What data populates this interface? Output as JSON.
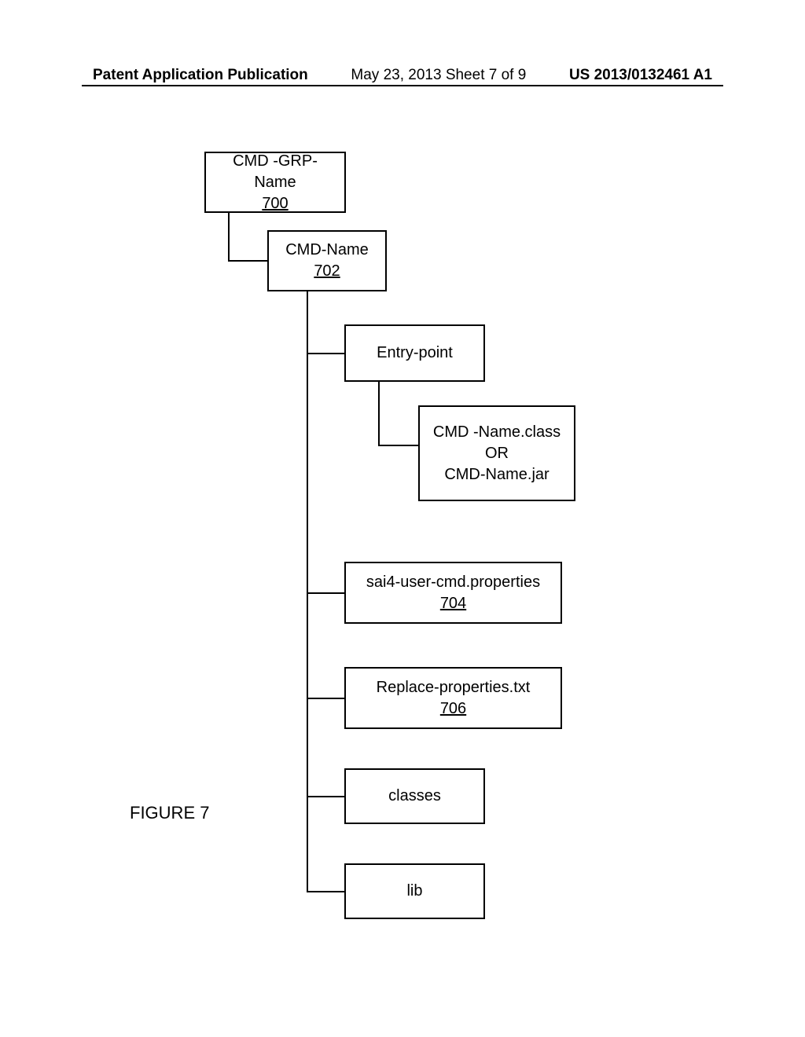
{
  "header": {
    "left": "Patent Application Publication",
    "center": "May 23, 2013  Sheet 7 of 9",
    "right": "US 2013/0132461 A1"
  },
  "boxes": {
    "cmd_grp": {
      "label": "CMD -GRP-Name",
      "ref": "700"
    },
    "cmd_name": {
      "label": "CMD-Name",
      "ref": "702"
    },
    "entry_point": {
      "label": "Entry-point"
    },
    "class_or_jar": {
      "label": "CMD -Name.class\nOR\nCMD-Name.jar"
    },
    "sai4": {
      "label": "sai4-user-cmd.properties",
      "ref": "704"
    },
    "replace": {
      "label": "Replace-properties.txt",
      "ref": "706"
    },
    "classes": {
      "label": "classes"
    },
    "lib": {
      "label": "lib"
    }
  },
  "figure_label": "FIGURE 7"
}
